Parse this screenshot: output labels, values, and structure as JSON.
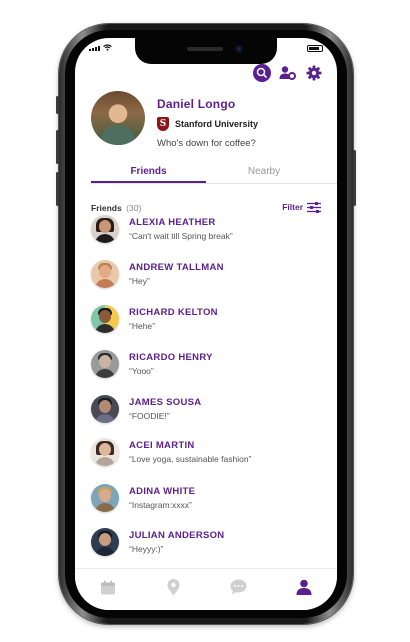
{
  "profile": {
    "name": "Daniel Longo",
    "school": "Stanford University",
    "school_logo_letter": "S",
    "status": "Who's down for coffee?"
  },
  "tabs": [
    {
      "label": "Friends",
      "active": true
    },
    {
      "label": "Nearby",
      "active": false
    }
  ],
  "friends_header": {
    "label": "Friends",
    "count": "(30)",
    "filter_label": "Filter"
  },
  "friends": [
    {
      "name": "ALEXIA HEATHER",
      "message": "“Can't wait till Spring break”"
    },
    {
      "name": "ANDREW TALLMAN",
      "message": "“Hey”"
    },
    {
      "name": "RICHARD KELTON",
      "message": "“Hehe”"
    },
    {
      "name": "RICARDO HENRY",
      "message": "“Yooo”"
    },
    {
      "name": "JAMES SOUSA",
      "message": "“FOODIE!”"
    },
    {
      "name": "ACEI MARTIN",
      "message": "“Love yoga, sustainable fashion”"
    },
    {
      "name": "ADINA WHITE",
      "message": "“Instagram:xxxx”"
    },
    {
      "name": "JULIAN ANDERSON",
      "message": "“Heyyy:)”"
    }
  ],
  "icons": {
    "header": [
      "search-icon",
      "add-friend-icon",
      "gear-icon"
    ],
    "bottom_nav": [
      "calendar-icon",
      "location-pin-icon",
      "chat-icon",
      "profile-icon"
    ]
  },
  "colors": {
    "accent": "#5b1f8e",
    "school_red": "#8c1515",
    "inactive_nav": "#c9c9c9"
  }
}
